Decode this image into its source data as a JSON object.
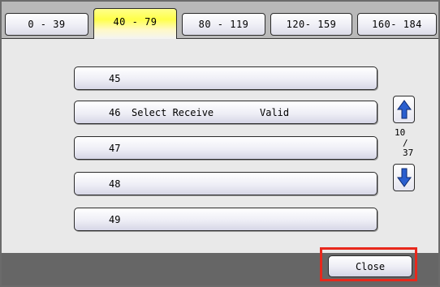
{
  "tabs": [
    {
      "label": "0 - 39",
      "active": false
    },
    {
      "label": "40 - 79",
      "active": true
    },
    {
      "label": "80 - 119",
      "active": false
    },
    {
      "label": "120- 159",
      "active": false
    },
    {
      "label": "160- 184",
      "active": false
    }
  ],
  "entries": [
    {
      "number": "45",
      "name": "",
      "status": ""
    },
    {
      "number": "46",
      "name": "Select Receive",
      "status": "Valid"
    },
    {
      "number": "47",
      "name": "",
      "status": ""
    },
    {
      "number": "48",
      "name": "",
      "status": ""
    },
    {
      "number": "49",
      "name": "",
      "status": ""
    }
  ],
  "pager": {
    "current": "10",
    "separator": "/",
    "total": "37"
  },
  "footer": {
    "close_label": "Close"
  },
  "colors": {
    "active_tab": "#ffff4a",
    "highlight": "#e8281c",
    "arrow": "#2a5fcf"
  }
}
